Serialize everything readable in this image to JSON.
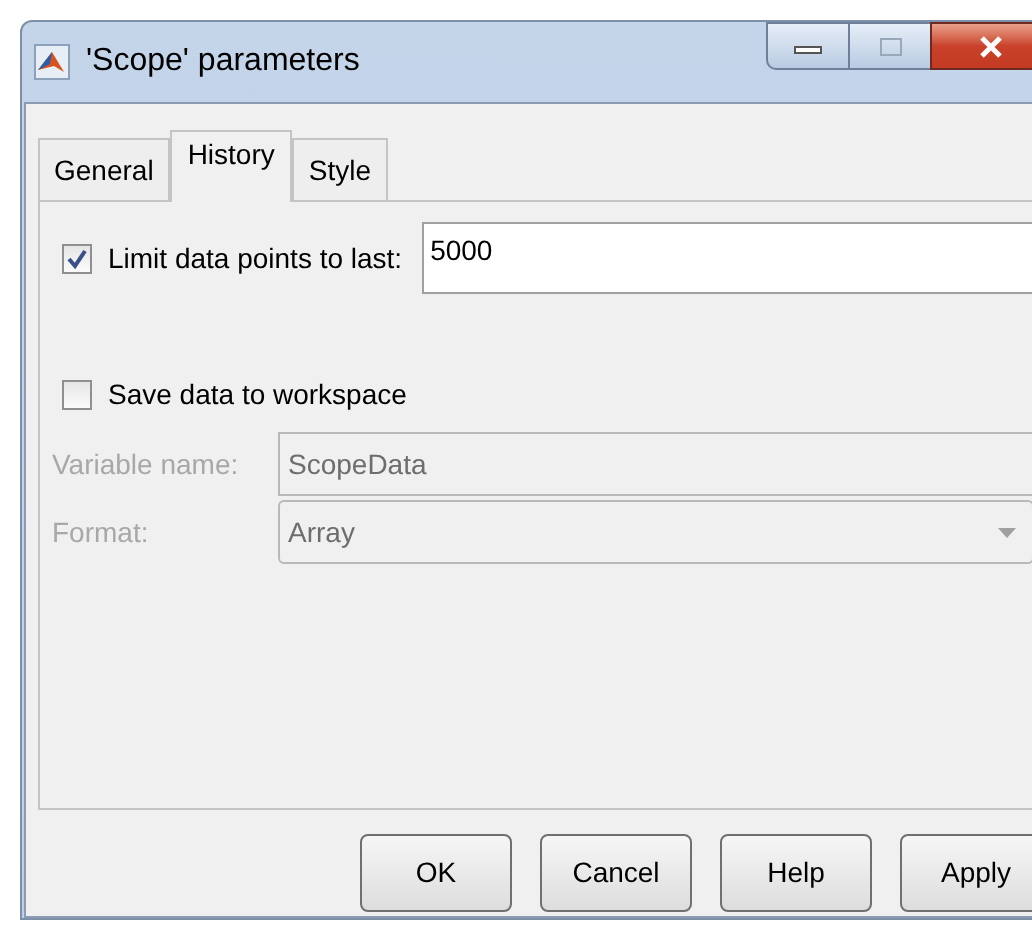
{
  "window": {
    "title": "'Scope' parameters"
  },
  "tabs": [
    {
      "label": "General",
      "selected": false
    },
    {
      "label": "History",
      "selected": true
    },
    {
      "label": "Style",
      "selected": false
    }
  ],
  "limit": {
    "label": "Limit data points to last:",
    "checked": true,
    "value": "5000"
  },
  "save": {
    "label": "Save data to workspace",
    "checked": false
  },
  "variable_name": {
    "label": "Variable name:",
    "value": "ScopeData",
    "disabled": true
  },
  "format": {
    "label": "Format:",
    "value": "Array",
    "disabled": true
  },
  "buttons": [
    "OK",
    "Cancel",
    "Help",
    "Apply"
  ]
}
